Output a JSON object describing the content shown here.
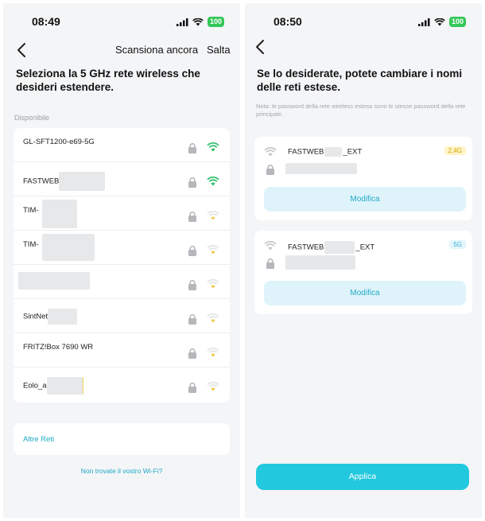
{
  "left": {
    "status": {
      "time": "08:49",
      "battery": "100"
    },
    "header": {
      "rescan_label": "Scansiona ancora",
      "skip_label": "Salta"
    },
    "title": "Seleziona la 5 GHz rete wireless che desideri estendere.",
    "section_label": "Disponibile",
    "networks": [
      {
        "ssid": "GL-SFT1200-e69-5G",
        "signal": "strong"
      },
      {
        "ssid": "FASTWEB",
        "signal": "strong"
      },
      {
        "ssid": "TIM-",
        "signal": "weak"
      },
      {
        "ssid": "TIM-",
        "signal": "weak"
      },
      {
        "ssid": "",
        "signal": "weak"
      },
      {
        "ssid": "SintNet",
        "signal": "weak"
      },
      {
        "ssid": "FRITZ!Box 7690 WR",
        "signal": "weak"
      },
      {
        "ssid": "Eolo_a",
        "signal": "weak"
      }
    ],
    "other_networks_label": "Altre Reti",
    "help_link": "Non trovate il vostro Wi-Fi?"
  },
  "right": {
    "status": {
      "time": "08:50",
      "battery": "100"
    },
    "title": "Se lo desiderate, potete cambiare i nomi delle reti estese.",
    "note": "Nota: le password della rete wireless estesa sono le stesse password della rete principale.",
    "networks": [
      {
        "name_prefix": "FASTWEB",
        "name_suffix": "_EXT",
        "band": "2,4G",
        "edit_label": "Modifica"
      },
      {
        "name_prefix": "FASTWEB",
        "name_suffix": "_EXT",
        "band": "5G",
        "edit_label": "Modifica"
      }
    ],
    "apply_label": "Applica"
  },
  "colors": {
    "accent": "#22c8de",
    "link": "#1da9c7",
    "wifi_strong": "#2fbf6a",
    "wifi_weak": "#f2c94c",
    "background": "#f4f5f7"
  },
  "icons": [
    "back-arrow-icon",
    "signal-icon",
    "wifi-icon",
    "battery-icon",
    "lock-icon"
  ]
}
